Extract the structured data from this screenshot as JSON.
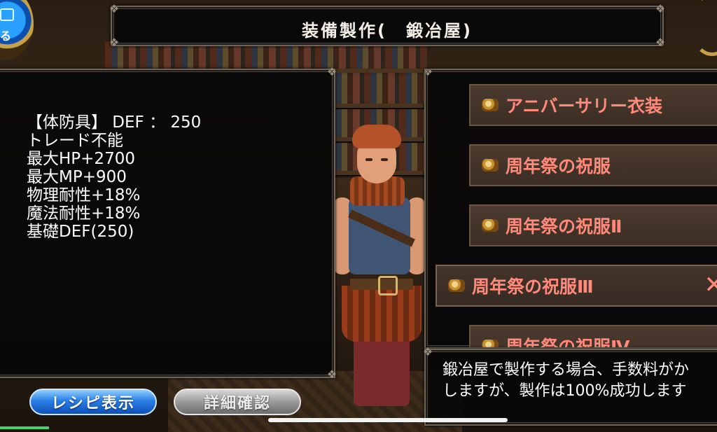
{
  "header": {
    "title": "装備製作(　鍛冶屋)"
  },
  "back_button": {
    "label": "る",
    "icon": "return-icon"
  },
  "item_stats": {
    "lines": [
      "【体防具】 DEF ： 250",
      "トレード不能",
      "最大HP+2700",
      "最大MP+900",
      "物理耐性+18%",
      "魔法耐性+18%",
      "基礎DEF(250)"
    ]
  },
  "recipe_list": {
    "items": [
      {
        "label": "アニバーサリー衣装",
        "icon": "scroll-icon",
        "selected": false
      },
      {
        "label": "周年祭の祝服",
        "icon": "scroll-icon",
        "selected": false
      },
      {
        "label": "周年祭の祝服Ⅱ",
        "icon": "scroll-icon",
        "selected": false
      },
      {
        "label": "周年祭の祝服Ⅲ",
        "icon": "scroll-icon",
        "selected": true
      },
      {
        "label": "周年祭の祝服Ⅳ",
        "icon": "scroll-icon",
        "selected": false
      }
    ],
    "remove_label": "✕"
  },
  "message": {
    "line1": "鍛冶屋で製作する場合、手数料がか",
    "line2": "しますが、製作は100%成功します"
  },
  "buttons": {
    "recipe": "レシピ表示",
    "detail": "詳細確認"
  },
  "colors": {
    "list_text": "#ff8a7c",
    "recipe_button": "#2a7fe6",
    "detail_button": "#9a9a9a",
    "progress": "#3cd46a"
  }
}
